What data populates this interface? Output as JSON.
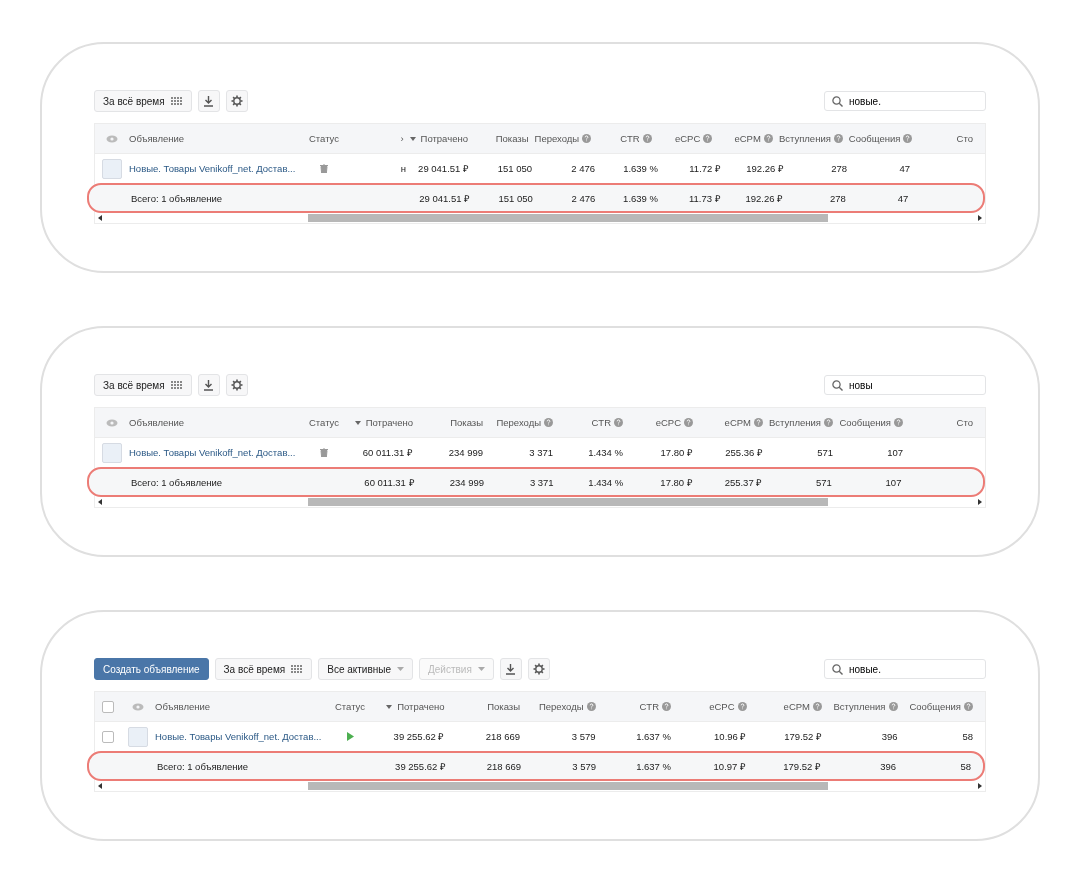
{
  "panels": [
    {
      "toolbar": [
        {
          "kind": "period",
          "label": "За всё время"
        },
        {
          "kind": "download"
        },
        {
          "kind": "settings"
        }
      ],
      "search": {
        "value": "новые."
      },
      "table": {
        "checkboxes": false,
        "columns": [
          {
            "label": "Статус",
            "help": false,
            "sorted": false
          },
          {
            "label": "›",
            "help": false,
            "sorted": false,
            "row": "н"
          },
          {
            "label": "Потрачено",
            "help": false,
            "sorted": true,
            "row": "29 041.51 ₽",
            "total": "29 041.51 ₽"
          },
          {
            "label": "Показы",
            "help": false,
            "sorted": false,
            "row": "151 050",
            "total": "151 050"
          },
          {
            "label": "Переходы",
            "help": true,
            "sorted": false,
            "row": "2 476",
            "total": "2 476"
          },
          {
            "label": "CTR",
            "help": true,
            "sorted": false,
            "row": "1.639 %",
            "total": "1.639 %"
          },
          {
            "label": "eCPC",
            "help": true,
            "sorted": false,
            "row": "11.72 ₽",
            "total": "11.73 ₽"
          },
          {
            "label": "eCPM",
            "help": true,
            "sorted": false,
            "row": "192.26 ₽",
            "total": "192.26 ₽"
          },
          {
            "label": "Вступления",
            "help": true,
            "sorted": false,
            "row": "278",
            "total": "278"
          },
          {
            "label": "Сообщения",
            "help": true,
            "sorted": false,
            "row": "47",
            "total": "47"
          },
          {
            "label": "Сто",
            "help": false,
            "sorted": false
          }
        ],
        "ad_header": "Объявление",
        "row": {
          "name": "Новые. Товары Venikoff_net. Достав...",
          "status": {
            "kind": "deleted"
          }
        },
        "total": {
          "label": "Всего: 1 объявление",
          "highlighted": true
        }
      }
    },
    {
      "toolbar": [
        {
          "kind": "period",
          "label": "За всё время"
        },
        {
          "kind": "download"
        },
        {
          "kind": "settings"
        }
      ],
      "search": {
        "value": "новы"
      },
      "table": {
        "checkboxes": false,
        "columns": [
          {
            "label": "Статус",
            "help": false,
            "sorted": false
          },
          {
            "label": "Потрачено",
            "help": false,
            "sorted": true,
            "row": "60 011.31 ₽",
            "total": "60 011.31 ₽"
          },
          {
            "label": "Показы",
            "help": false,
            "sorted": false,
            "row": "234 999",
            "total": "234 999"
          },
          {
            "label": "Переходы",
            "help": true,
            "sorted": false,
            "row": "3 371",
            "total": "3 371"
          },
          {
            "label": "CTR",
            "help": true,
            "sorted": false,
            "row": "1.434 %",
            "total": "1.434 %"
          },
          {
            "label": "eCPC",
            "help": true,
            "sorted": false,
            "row": "17.80 ₽",
            "total": "17.80 ₽"
          },
          {
            "label": "eCPM",
            "help": true,
            "sorted": false,
            "row": "255.36 ₽",
            "total": "255.37 ₽"
          },
          {
            "label": "Вступления",
            "help": true,
            "sorted": false,
            "row": "571",
            "total": "571"
          },
          {
            "label": "Сообщения",
            "help": true,
            "sorted": false,
            "row": "107",
            "total": "107"
          },
          {
            "label": "Сто",
            "help": false,
            "sorted": false
          }
        ],
        "ad_header": "Объявление",
        "row": {
          "name": "Новые. Товары Venikoff_net. Достав...",
          "status": {
            "kind": "deleted"
          }
        },
        "total": {
          "label": "Всего: 1 объявление",
          "highlighted": true
        }
      }
    },
    {
      "toolbar": [
        {
          "kind": "primary",
          "label": "Создать объявление"
        },
        {
          "kind": "period",
          "label": "За всё время"
        },
        {
          "kind": "dropdown",
          "label": "Все активные",
          "disabled": false
        },
        {
          "kind": "dropdown",
          "label": "Действия",
          "disabled": true
        },
        {
          "kind": "download"
        },
        {
          "kind": "settings"
        }
      ],
      "search": {
        "value": "новые."
      },
      "table": {
        "checkboxes": true,
        "all_checked": false,
        "columns": [
          {
            "label": "Статус",
            "help": false,
            "sorted": false
          },
          {
            "label": "Потрачено",
            "help": false,
            "sorted": true,
            "row": "39 255.62 ₽",
            "total": "39 255.62 ₽"
          },
          {
            "label": "Показы",
            "help": false,
            "sorted": false,
            "row": "218 669",
            "total": "218 669"
          },
          {
            "label": "Переходы",
            "help": true,
            "sorted": false,
            "row": "3 579",
            "total": "3 579"
          },
          {
            "label": "CTR",
            "help": true,
            "sorted": false,
            "row": "1.637 %",
            "total": "1.637 %"
          },
          {
            "label": "eCPC",
            "help": true,
            "sorted": false,
            "row": "10.96 ₽",
            "total": "10.97 ₽"
          },
          {
            "label": "eCPM",
            "help": true,
            "sorted": false,
            "row": "179.52 ₽",
            "total": "179.52 ₽"
          },
          {
            "label": "Вступления",
            "help": true,
            "sorted": false,
            "row": "396",
            "total": "396"
          },
          {
            "label": "Сообщения",
            "help": true,
            "sorted": false,
            "row": "58",
            "total": "58"
          }
        ],
        "ad_header": "Объявление",
        "row": {
          "name": "Новые. Товары Venikoff_net. Достав...",
          "status": {
            "kind": "active"
          },
          "checked": false
        },
        "total": {
          "label": "Всего: 1 объявление",
          "highlighted": true
        }
      }
    }
  ]
}
